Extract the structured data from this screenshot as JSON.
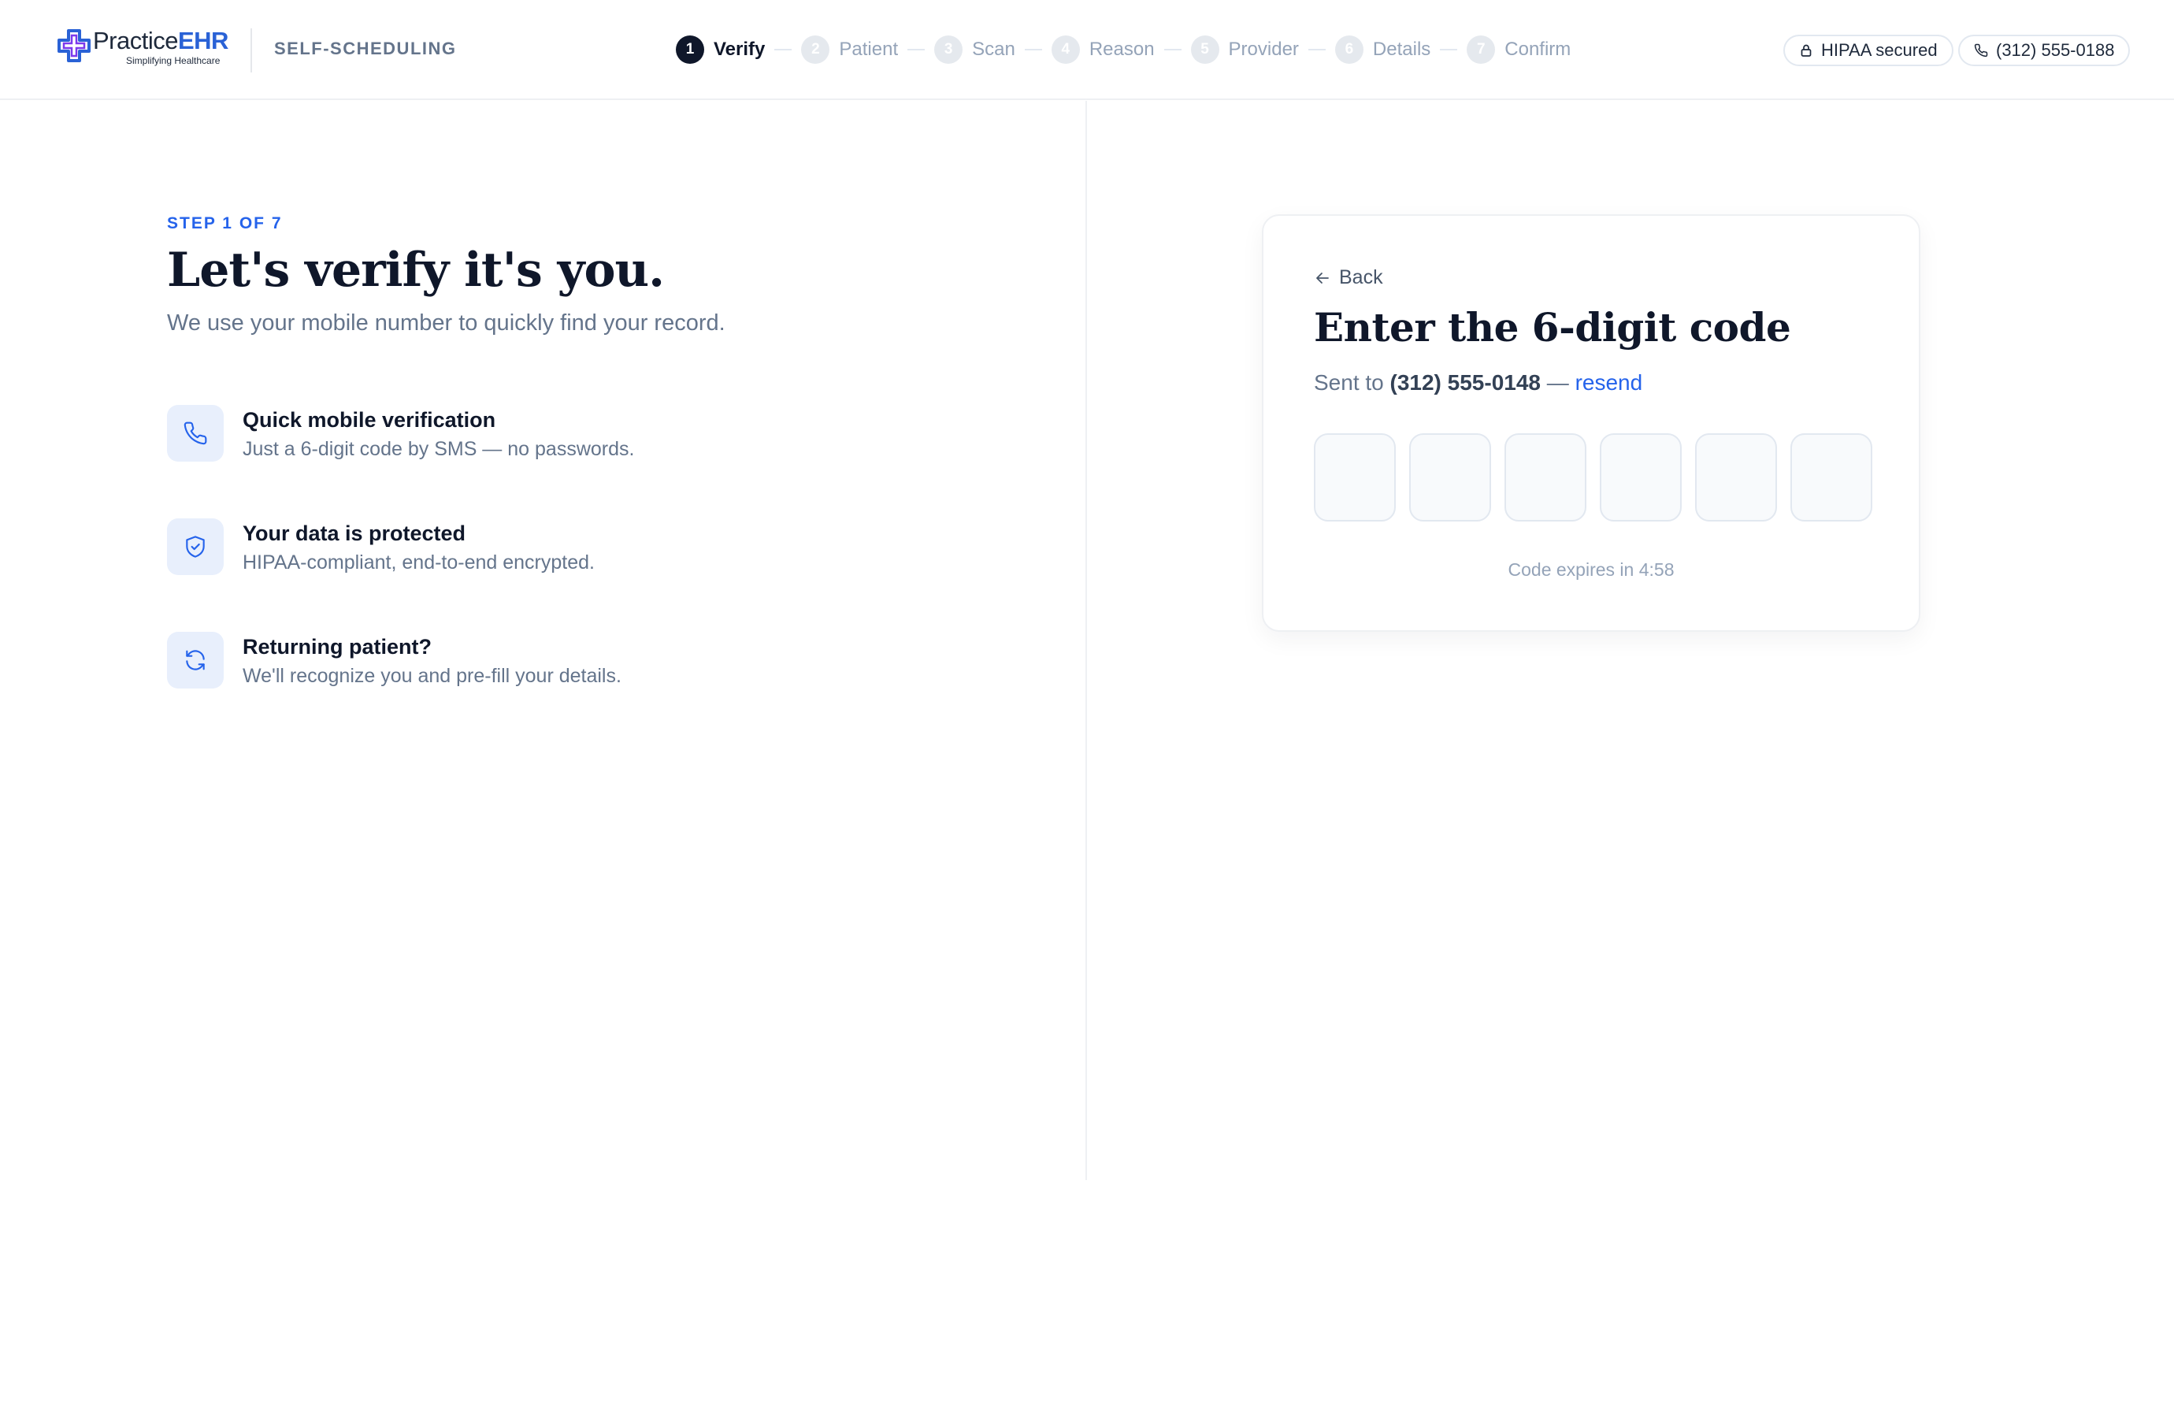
{
  "header": {
    "logo_practice": "Practice",
    "logo_ehr": "EHR",
    "logo_tagline": "Simplifying Healthcare",
    "section_label": "SELF-SCHEDULING",
    "steps": [
      {
        "num": "1",
        "label": "Verify",
        "active": true
      },
      {
        "num": "2",
        "label": "Patient"
      },
      {
        "num": "3",
        "label": "Scan"
      },
      {
        "num": "4",
        "label": "Reason"
      },
      {
        "num": "5",
        "label": "Provider"
      },
      {
        "num": "6",
        "label": "Details"
      },
      {
        "num": "7",
        "label": "Confirm"
      }
    ],
    "hipaa_label": "HIPAA secured",
    "phone_label": "(312) 555-0188"
  },
  "left": {
    "kicker": "STEP 1 OF 7",
    "title": "Let's verify it's you.",
    "subtitle": "We use your mobile number to quickly find your record.",
    "features": [
      {
        "icon": "phone-icon",
        "title": "Quick mobile verification",
        "desc": "Just a 6-digit code by SMS — no passwords."
      },
      {
        "icon": "shield-check-icon",
        "title": "Your data is protected",
        "desc": "HIPAA-compliant, end-to-end encrypted."
      },
      {
        "icon": "refresh-icon",
        "title": "Returning patient?",
        "desc": "We'll recognize you and pre-fill your details."
      }
    ]
  },
  "card": {
    "back_label": "Back",
    "title": "Enter the 6-digit code",
    "sent_prefix": "Sent to ",
    "sent_phone": "(312) 555-0148",
    "sent_sep": " — ",
    "resend_label": "resend",
    "otp_values": [
      "",
      "",
      "",
      "",
      "",
      ""
    ],
    "expires_text": "Code expires in 4:58"
  },
  "colors": {
    "accent": "#2563eb",
    "brand_ehr": "#2a62d6",
    "active_step": "#0f172a",
    "muted": "#64748b",
    "icon_bg": "#e8effc"
  }
}
